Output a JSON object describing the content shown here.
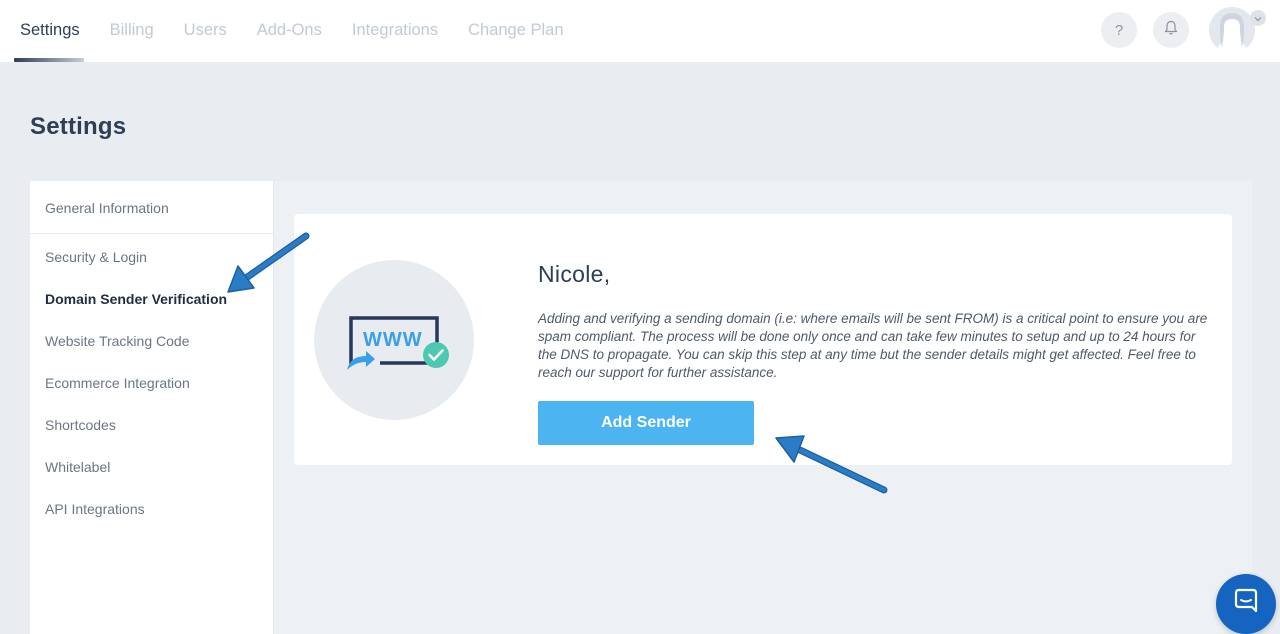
{
  "topnav": {
    "tabs": [
      {
        "label": "Settings",
        "active": true
      },
      {
        "label": "Billing"
      },
      {
        "label": "Users"
      },
      {
        "label": "Add-Ons"
      },
      {
        "label": "Integrations"
      },
      {
        "label": "Change Plan"
      }
    ],
    "help_label": "?",
    "help_icon": "question-icon",
    "bell_icon": "bell-icon",
    "avatar_icon": "user-avatar-icon",
    "caret_icon": "chevron-down-icon"
  },
  "page": {
    "title": "Settings"
  },
  "sidebar": {
    "items": [
      {
        "label": "General Information"
      },
      {
        "label": "Security & Login"
      },
      {
        "label": "Domain Sender Verification",
        "active": true
      },
      {
        "label": "Website Tracking Code"
      },
      {
        "label": "Ecommerce Integration"
      },
      {
        "label": "Shortcodes"
      },
      {
        "label": "Whitelabel"
      },
      {
        "label": "API Integrations"
      }
    ]
  },
  "card": {
    "illustration_icon": "www-domain-verified-icon",
    "illustration_text": "WWW",
    "greeting": "Nicole,",
    "description": "Adding and verifying a sending domain (i.e: where emails will be sent FROM) is a critical point to ensure you are spam compliant. The process will be done only once and can take few minutes to setup and up to 24 hours for the DNS to propagate. You can skip this step at any time but the sender details might get affected. Feel free to reach our support for further assistance.",
    "button_label": "Add Sender"
  },
  "chat": {
    "icon": "chat-bubble-icon"
  },
  "colors": {
    "accent": "#4bb4f1",
    "title": "#2d3e55",
    "background": "#e9edf1",
    "chat": "#1565c0",
    "check": "#4cc9b0",
    "annotation_arrow": "#2a7cc7"
  }
}
